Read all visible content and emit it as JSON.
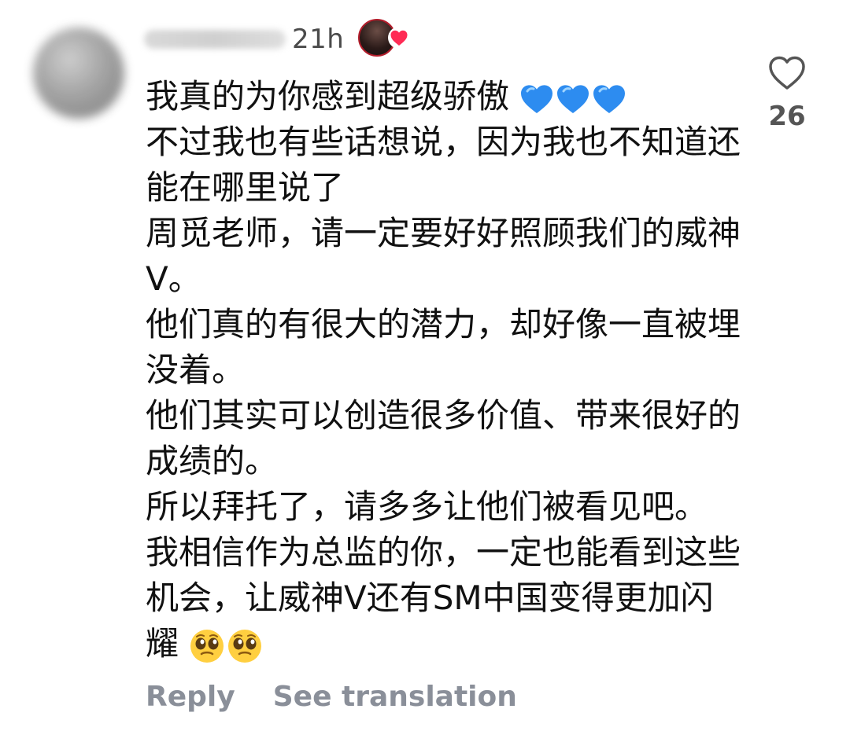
{
  "comment": {
    "time": "21h",
    "likes_count": "26",
    "lines": [
      "我真的为你感到超级骄傲",
      "不过我也有些话想说，因为我也不知道还",
      "能在哪里说了",
      "周觅老师，请一定要好好照顾我们的威神",
      "V。",
      "他们真的有很大的潜力，却好像一直被埋",
      "没着。",
      "他们其实可以创造很多价值、带来很好的",
      "成绩的。",
      "所以拜托了，请多多让他们被看见吧。",
      "我相信作为总监的你，一定也能看到这些",
      "机会，让威神V还有SM中国变得更加闪",
      "耀"
    ],
    "line1_emoji": "blue-heart-emoji",
    "last_line_emoji": "pleading-face-emoji"
  },
  "actions": {
    "reply_label": "Reply",
    "translation_label": "See translation"
  },
  "icons": {
    "like": "heart-outline-icon",
    "creator_like": "red-heart-icon"
  },
  "colors": {
    "text": "#111111",
    "meta": "#4b4b4b",
    "action": "#8a8f99",
    "heart_blue": "#2d8cf0",
    "creator_heart": "#ff2b55"
  }
}
